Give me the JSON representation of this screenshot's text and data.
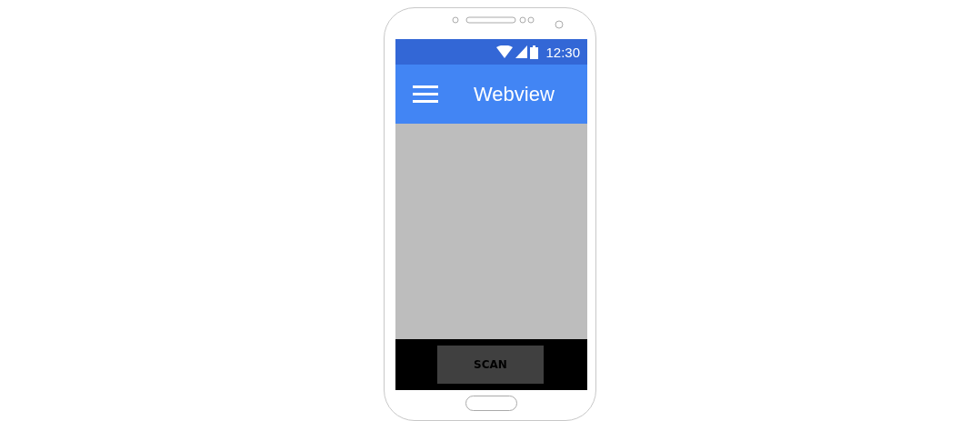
{
  "status_bar": {
    "time": "12:30"
  },
  "app_bar": {
    "title": "Webview"
  },
  "bottom_bar": {
    "buttons": [
      "SCAN"
    ]
  }
}
